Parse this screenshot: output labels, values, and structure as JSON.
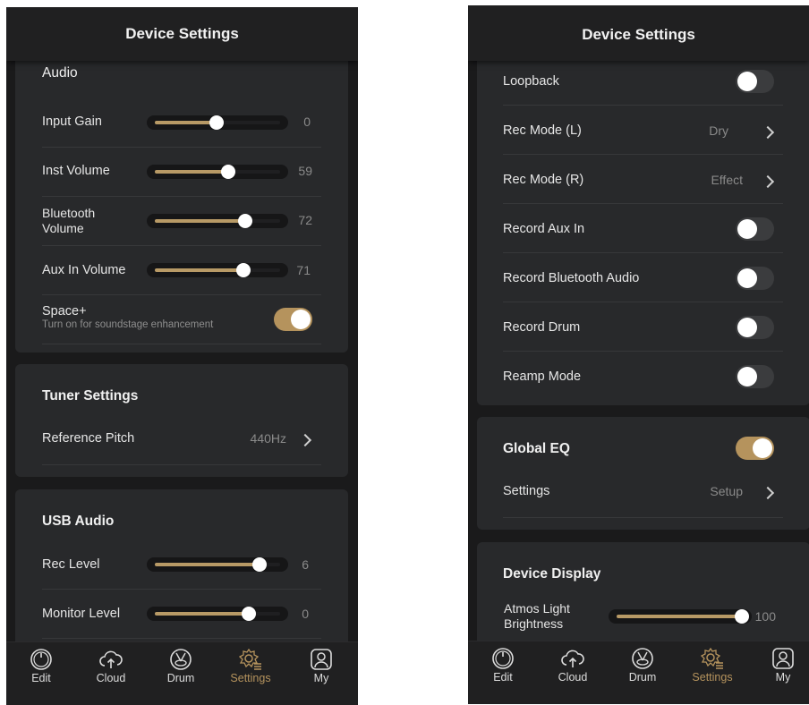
{
  "left": {
    "header_title": "Device Settings",
    "audio": {
      "title": "Audio",
      "input_gain": {
        "label": "Input Gain",
        "value": "0",
        "level": 0.5
      },
      "inst_volume": {
        "label": "Inst Volume",
        "value": "59",
        "level": 0.59
      },
      "bluetooth_volume": {
        "label1": "Bluetooth",
        "label2": "Volume",
        "value": "72",
        "level": 0.72
      },
      "aux_in_volume": {
        "label": "Aux In Volume",
        "value": "71",
        "level": 0.71
      },
      "space_plus": {
        "label": "Space+",
        "sublabel": "Turn on for soundstage enhancement",
        "on": true
      }
    },
    "tuner": {
      "title": "Tuner Settings",
      "reference_pitch": {
        "label": "Reference Pitch",
        "value": "440Hz"
      }
    },
    "usb_audio": {
      "title": "USB Audio",
      "rec_level": {
        "label": "Rec Level",
        "value": "6",
        "level": 0.86
      },
      "monitor_level": {
        "label": "Monitor Level",
        "value": "0",
        "level": 0.72
      }
    }
  },
  "right": {
    "header_title": "Device Settings",
    "loopback": {
      "label": "Loopback",
      "on": false
    },
    "rec_mode_l": {
      "label": "Rec Mode (L)",
      "value": "Dry"
    },
    "rec_mode_r": {
      "label": "Rec Mode (R)",
      "value": "Effect"
    },
    "record_aux_in": {
      "label": "Record Aux In",
      "on": false
    },
    "record_bluetooth_audio": {
      "label": "Record Bluetooth Audio",
      "on": false
    },
    "record_drum": {
      "label": "Record Drum",
      "on": false
    },
    "reamp_mode": {
      "label": "Reamp Mode",
      "on": false
    },
    "global_eq": {
      "title": "Global EQ",
      "on": true,
      "settings_label": "Settings",
      "settings_value": "Setup"
    },
    "device_display": {
      "title": "Device Display",
      "atmos": {
        "label1": "Atmos Light",
        "label2": "Brightness",
        "value": "100",
        "level": 1.0
      }
    }
  },
  "tabs": [
    {
      "label": "Edit",
      "icon": "power-knob-icon"
    },
    {
      "label": "Cloud",
      "icon": "cloud-icon"
    },
    {
      "label": "Drum",
      "icon": "drum-icon"
    },
    {
      "label": "Settings",
      "icon": "gear-icon",
      "active": true
    },
    {
      "label": "My",
      "icon": "user-icon"
    }
  ],
  "colors": {
    "accent": "#b5935d",
    "background": "#1a1a1b",
    "card": "#28292b"
  }
}
